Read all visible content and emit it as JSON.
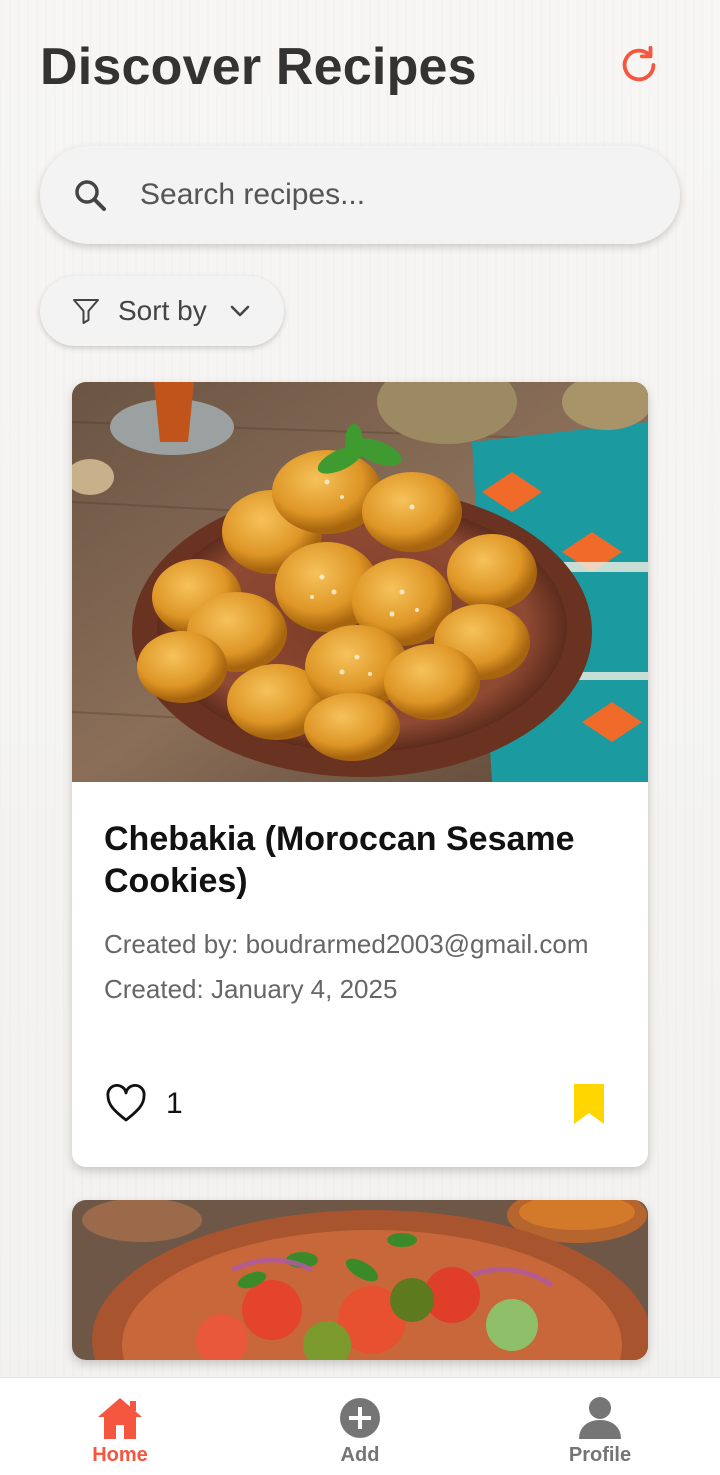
{
  "header": {
    "title": "Discover Recipes",
    "refresh_icon": "refresh-icon",
    "accent_color": "#f4563f"
  },
  "search": {
    "placeholder": "Search recipes...",
    "value": "",
    "icon": "search-icon"
  },
  "sort": {
    "label": "Sort by",
    "icon": "filter-icon",
    "chevron": "chevron-down-icon"
  },
  "recipes": [
    {
      "title": "Chebakia (Moroccan Sesame Cookies)",
      "creator": "Created by: boudrarmed2003@gmail.com",
      "created": "Created: January 4, 2025",
      "likes": "1",
      "liked": false,
      "bookmarked": true,
      "bookmark_color": "#ffd600"
    },
    {
      "title": "",
      "creator": "",
      "created": "",
      "likes": ""
    }
  ],
  "bottom_nav": {
    "items": [
      {
        "label": "Home",
        "icon": "home-icon",
        "active": true
      },
      {
        "label": "Add",
        "icon": "add-circle-icon",
        "active": false
      },
      {
        "label": "Profile",
        "icon": "person-icon",
        "active": false
      }
    ]
  }
}
